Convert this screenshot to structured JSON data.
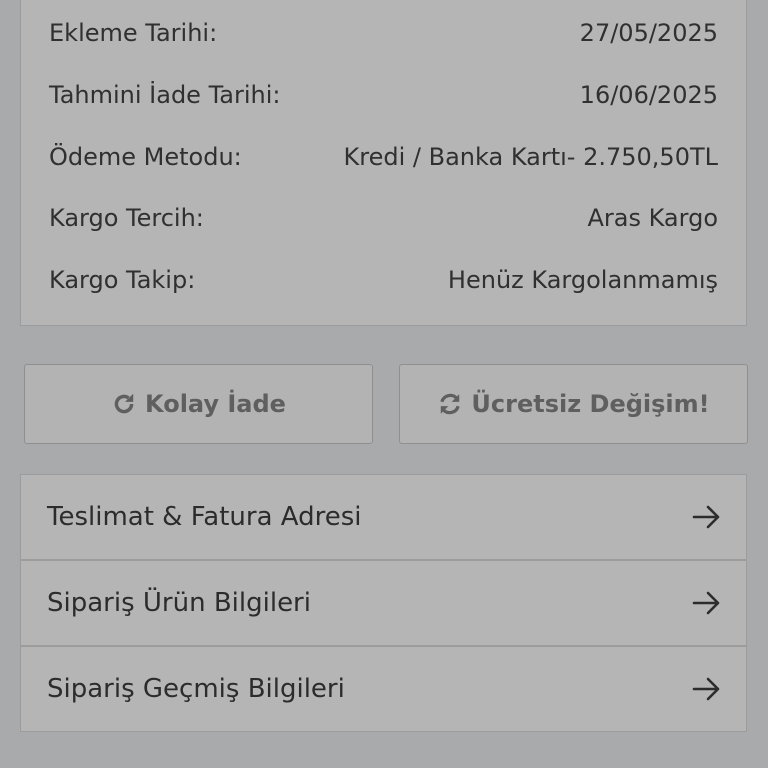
{
  "order_info": {
    "rows": [
      {
        "label": "Ekleme Tarihi:",
        "value": "27/05/2025"
      },
      {
        "label": "Tahmini İade Tarihi:",
        "value": "16/06/2025"
      },
      {
        "label": "Ödeme Metodu:",
        "value": "Kredi / Banka Kartı- 2.750,50TL"
      },
      {
        "label": "Kargo Tercih:",
        "value": "Aras Kargo"
      },
      {
        "label": "Kargo Takip:",
        "value": "Henüz Kargolanmamış"
      }
    ]
  },
  "actions": {
    "easy_return": {
      "label": "Kolay İade",
      "icon": "rotate-cw-icon"
    },
    "free_exchange": {
      "label": "Ücretsiz Değişim!",
      "icon": "refresh-icon"
    }
  },
  "links": [
    {
      "label": "Teslimat & Fatura Adresi",
      "icon": "arrow-right-icon"
    },
    {
      "label": "Sipariş Ürün Bilgileri",
      "icon": "arrow-right-icon"
    },
    {
      "label": "Sipariş Geçmiş Bilgileri",
      "icon": "arrow-right-icon"
    }
  ],
  "colors": {
    "background": "#a9aaac",
    "card": "#b5b5b5",
    "button_text": "#5f5f5f",
    "text": "#2c2c2c"
  }
}
